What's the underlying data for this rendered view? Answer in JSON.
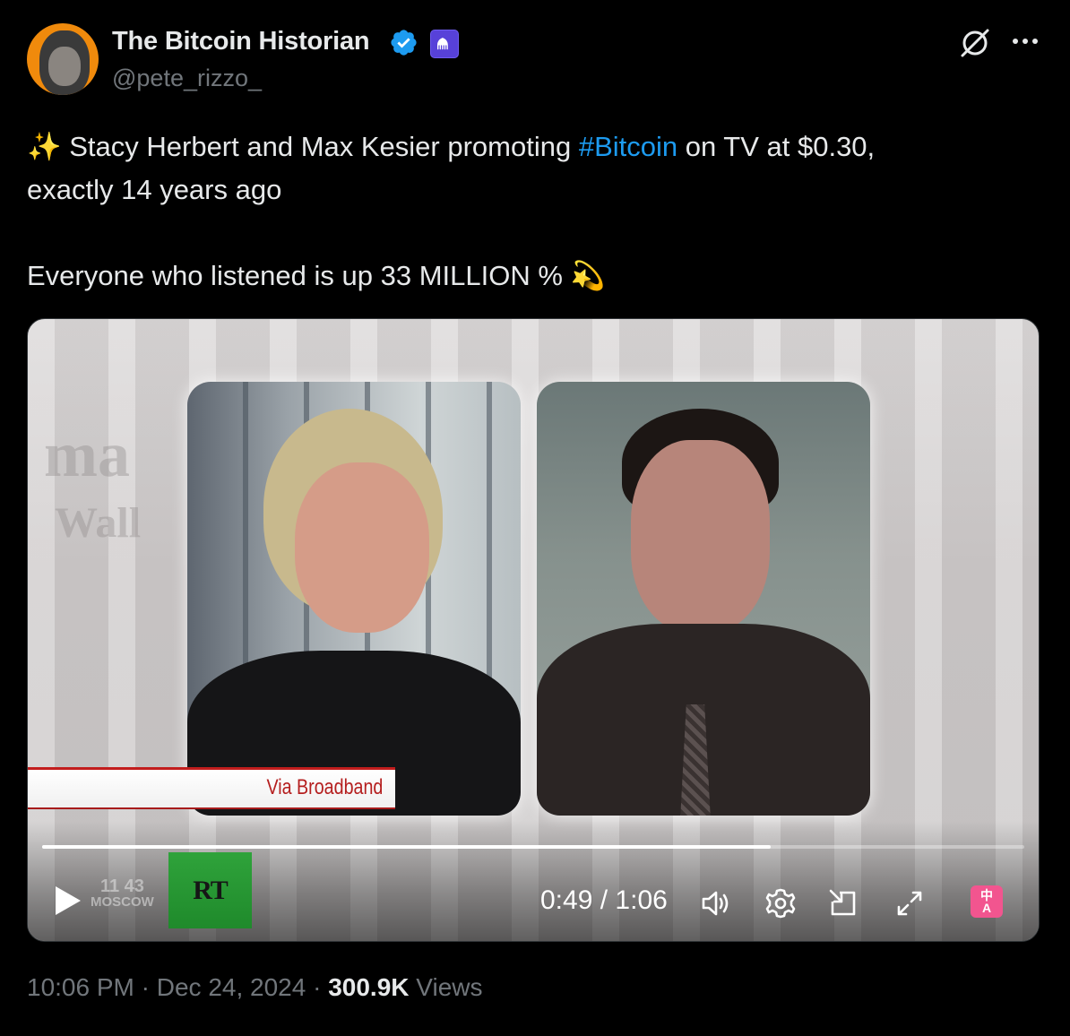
{
  "author": {
    "display_name": "The Bitcoin Historian",
    "handle": "@pete_rizzo_"
  },
  "tweet": {
    "line1_prefix": "Stacy Herbert and Max Kesier promoting",
    "hashtag": "#Bitcoin",
    "line1_suffix": "on TV at $0.30,",
    "line2": "exactly 14 years ago",
    "line3": "Everyone who listened is up 33 MILLION %",
    "emoji_start": "✨",
    "emoji_end": "💫"
  },
  "video": {
    "lower_third": "Via Broadband",
    "channel_logo": "RT",
    "clock_time": "11 43",
    "clock_city": "MOSCOW",
    "current_time": "0:49",
    "separator": "/",
    "duration": "1:06",
    "progress_fraction": 0.742,
    "translate_label_top": "中",
    "translate_label_bottom": "A",
    "icons": {
      "play": "play-icon",
      "volume": "volume-icon",
      "settings": "gear-icon",
      "pip": "picture-in-picture-icon",
      "fullscreen": "fullscreen-icon",
      "translate": "translate-icon"
    }
  },
  "footer": {
    "time": "10:06 PM",
    "dot1": "·",
    "date": "Dec 24, 2024",
    "dot2": "·",
    "views_count": "300.9K",
    "views_label": "Views"
  },
  "colors": {
    "background": "#000000",
    "text": "#e7e9ea",
    "muted": "#71767b",
    "link": "#1d9bf0",
    "verified": "#1d9bf0",
    "affiliate": "#5741d9"
  }
}
